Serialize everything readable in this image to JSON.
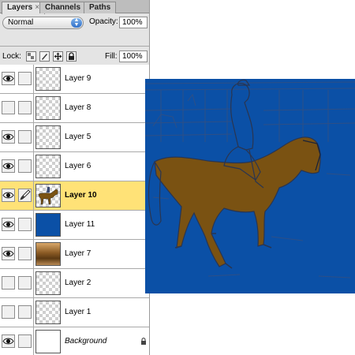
{
  "tabs": [
    {
      "label": "Layers",
      "active": true
    },
    {
      "label": "Channels",
      "active": false
    },
    {
      "label": "Paths",
      "active": false
    }
  ],
  "tab_close": "×",
  "blend_mode": "Normal",
  "opacity_label": "Opacity:",
  "opacity_value": "100%",
  "lock_label": "Lock:",
  "fill_label": "Fill:",
  "fill_value": "100%",
  "layers": [
    {
      "name": "Layer 9",
      "visible": true,
      "thumb": "checker"
    },
    {
      "name": "Layer 8",
      "visible": false,
      "thumb": "checker"
    },
    {
      "name": "Layer 5",
      "visible": true,
      "thumb": "checker"
    },
    {
      "name": "Layer 6",
      "visible": true,
      "thumb": "checker"
    },
    {
      "name": "Layer 10",
      "visible": true,
      "selected": true,
      "thumb": "horse",
      "brush": true
    },
    {
      "name": "Layer 11",
      "visible": true,
      "thumb": "blue"
    },
    {
      "name": "Layer 7",
      "visible": true,
      "thumb": "brown-gradient"
    },
    {
      "name": "Layer 2",
      "visible": false,
      "thumb": "checker"
    },
    {
      "name": "Layer 1",
      "visible": false,
      "thumb": "checker"
    },
    {
      "name": "Background",
      "visible": true,
      "thumb": "white",
      "locked": true
    }
  ],
  "colors": {
    "selection": "#ffe277",
    "canvas_blue": "#0b50a6",
    "horse_brown": "#7a5212",
    "line_art": "#2a3550"
  },
  "icons": [
    "eye-icon",
    "brush-icon",
    "lock-icon",
    "lock-transparent-icon",
    "lock-paint-icon",
    "lock-move-icon",
    "lock-all-icon",
    "dropdown-arrow-icon"
  ]
}
